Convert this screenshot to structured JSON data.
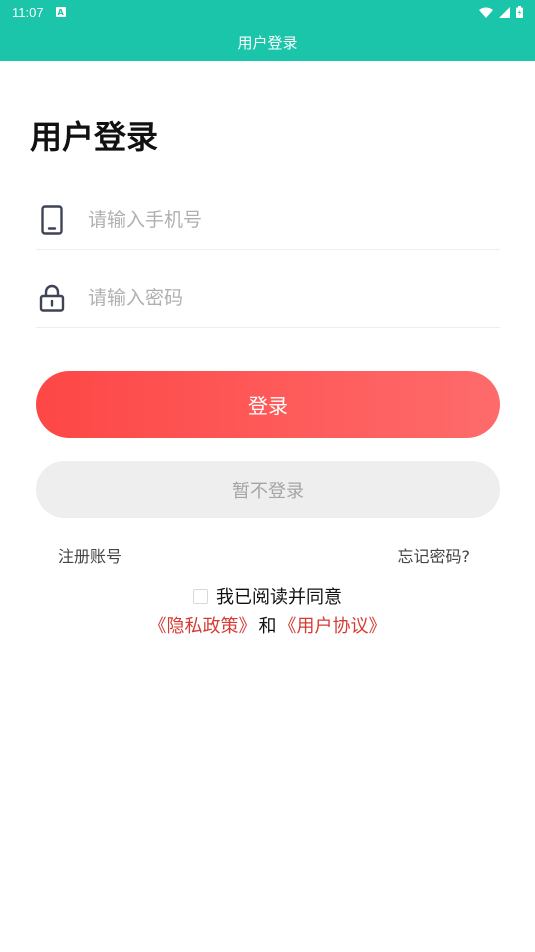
{
  "status_bar": {
    "time": "11:07",
    "notification_glyph": "A",
    "icons": [
      "wifi-icon",
      "signal-icon",
      "battery-icon"
    ]
  },
  "app_bar": {
    "title": "用户登录"
  },
  "page": {
    "heading": "用户登录"
  },
  "phone_field": {
    "placeholder": "请输入手机号",
    "value": ""
  },
  "password_field": {
    "placeholder": "请输入密码",
    "value": ""
  },
  "buttons": {
    "login": "登录",
    "skip_login": "暂不登录"
  },
  "links": {
    "register": "注册账号",
    "forgot_password": "忘记密码?"
  },
  "agreement": {
    "checked": false,
    "text": "我已阅读并同意",
    "privacy_policy": "《隐私政策》",
    "and": "和",
    "user_agreement": "《用户协议》"
  },
  "colors": {
    "primary": "#1ac5a9",
    "login_gradient_start": "#fd4746",
    "login_gradient_end": "#fe6b6b",
    "link_red": "#d63b33"
  }
}
